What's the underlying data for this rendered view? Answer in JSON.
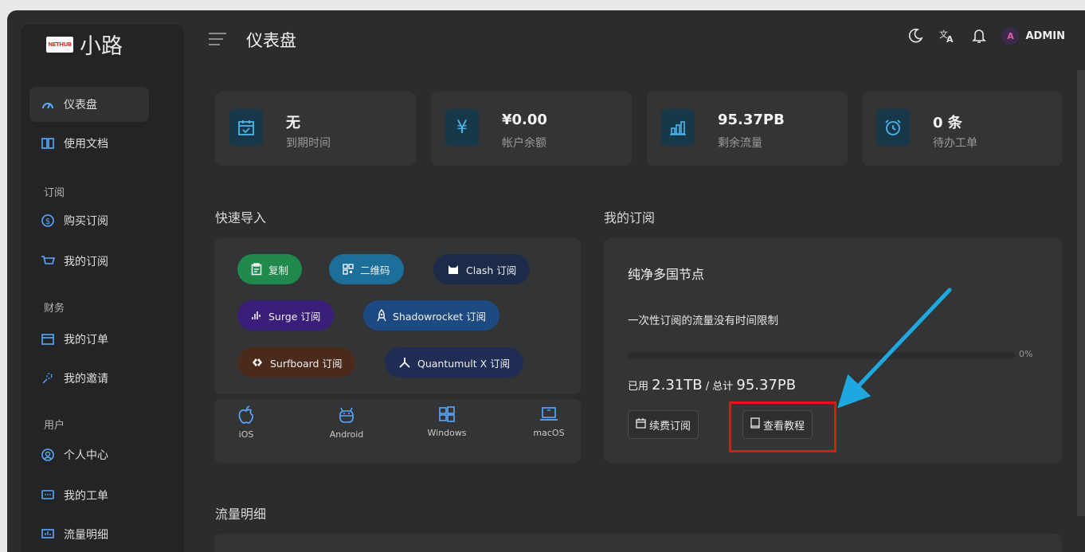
{
  "brand": {
    "logo_text": "NETHUB",
    "name": "小路"
  },
  "header": {
    "title": "仪表盘",
    "user_initial": "A",
    "user_name": "ADMIN"
  },
  "sidebar": {
    "items": [
      {
        "label": "仪表盘",
        "icon": "dashboard-icon",
        "active": true
      },
      {
        "label": "使用文档",
        "icon": "book-icon"
      }
    ],
    "sections": [
      {
        "title": "订阅",
        "items": [
          {
            "label": "购买订阅",
            "icon": "dollar-icon"
          },
          {
            "label": "我的订阅",
            "icon": "cart-icon"
          }
        ]
      },
      {
        "title": "财务",
        "items": [
          {
            "label": "我的订单",
            "icon": "wallet-icon"
          },
          {
            "label": "我的邀请",
            "icon": "invite-icon"
          }
        ]
      },
      {
        "title": "用户",
        "items": [
          {
            "label": "个人中心",
            "icon": "user-icon"
          },
          {
            "label": "我的工单",
            "icon": "ticket-icon"
          },
          {
            "label": "流量明细",
            "icon": "traffic-icon"
          }
        ]
      }
    ]
  },
  "stats": [
    {
      "value": "无",
      "label": "到期时间",
      "icon": "calendar-icon"
    },
    {
      "value": "¥0.00",
      "label": "帐户余额",
      "icon": "yen-icon"
    },
    {
      "value": "95.37PB",
      "label": "剩余流量",
      "icon": "bar-chart-icon"
    },
    {
      "value": "0 条",
      "label": "待办工单",
      "icon": "alarm-icon"
    }
  ],
  "quick_import": {
    "title": "快速导入",
    "buttons": [
      {
        "label": "复制",
        "color": "#1f8a4c",
        "icon": "clipboard-icon"
      },
      {
        "label": "二维码",
        "color": "#1d6f9a",
        "icon": "qrcode-icon"
      },
      {
        "label": "Clash 订阅",
        "color": "#1c2b4a",
        "icon": "clash-icon"
      },
      {
        "label": "Surge 订阅",
        "color": "#3a1f7a",
        "icon": "surge-icon"
      },
      {
        "label": "Shadowrocket 订阅",
        "color": "#1d4a80",
        "icon": "rocket-icon"
      },
      {
        "label": "Surfboard 订阅",
        "color": "#4a2a1a",
        "icon": "surfboard-icon"
      },
      {
        "label": "Quantumult X 订阅",
        "color": "#1f2d55",
        "icon": "quantumult-icon"
      }
    ],
    "platforms": [
      {
        "label": "iOS",
        "icon": "apple-icon"
      },
      {
        "label": "Android",
        "icon": "android-icon"
      },
      {
        "label": "Windows",
        "icon": "windows-icon"
      },
      {
        "label": "macOS",
        "icon": "laptop-icon"
      }
    ]
  },
  "subscription": {
    "title": "我的订阅",
    "plan_name": "纯净多国节点",
    "description": "一次性订阅的流量没有时间限制",
    "progress_fraction": 0.0,
    "progress_label": "0%",
    "used_prefix": "已用",
    "used_value": "2.31TB",
    "total_prefix": "/ 总计",
    "total_value": "95.37PB",
    "renew_label": "续费订阅",
    "tutorial_label": "查看教程"
  },
  "traffic": {
    "title": "流量明细"
  },
  "colors": {
    "accent": "#4fb4ea",
    "annotation_arrow": "#1fa8e0",
    "annotation_box": "#e01616"
  }
}
